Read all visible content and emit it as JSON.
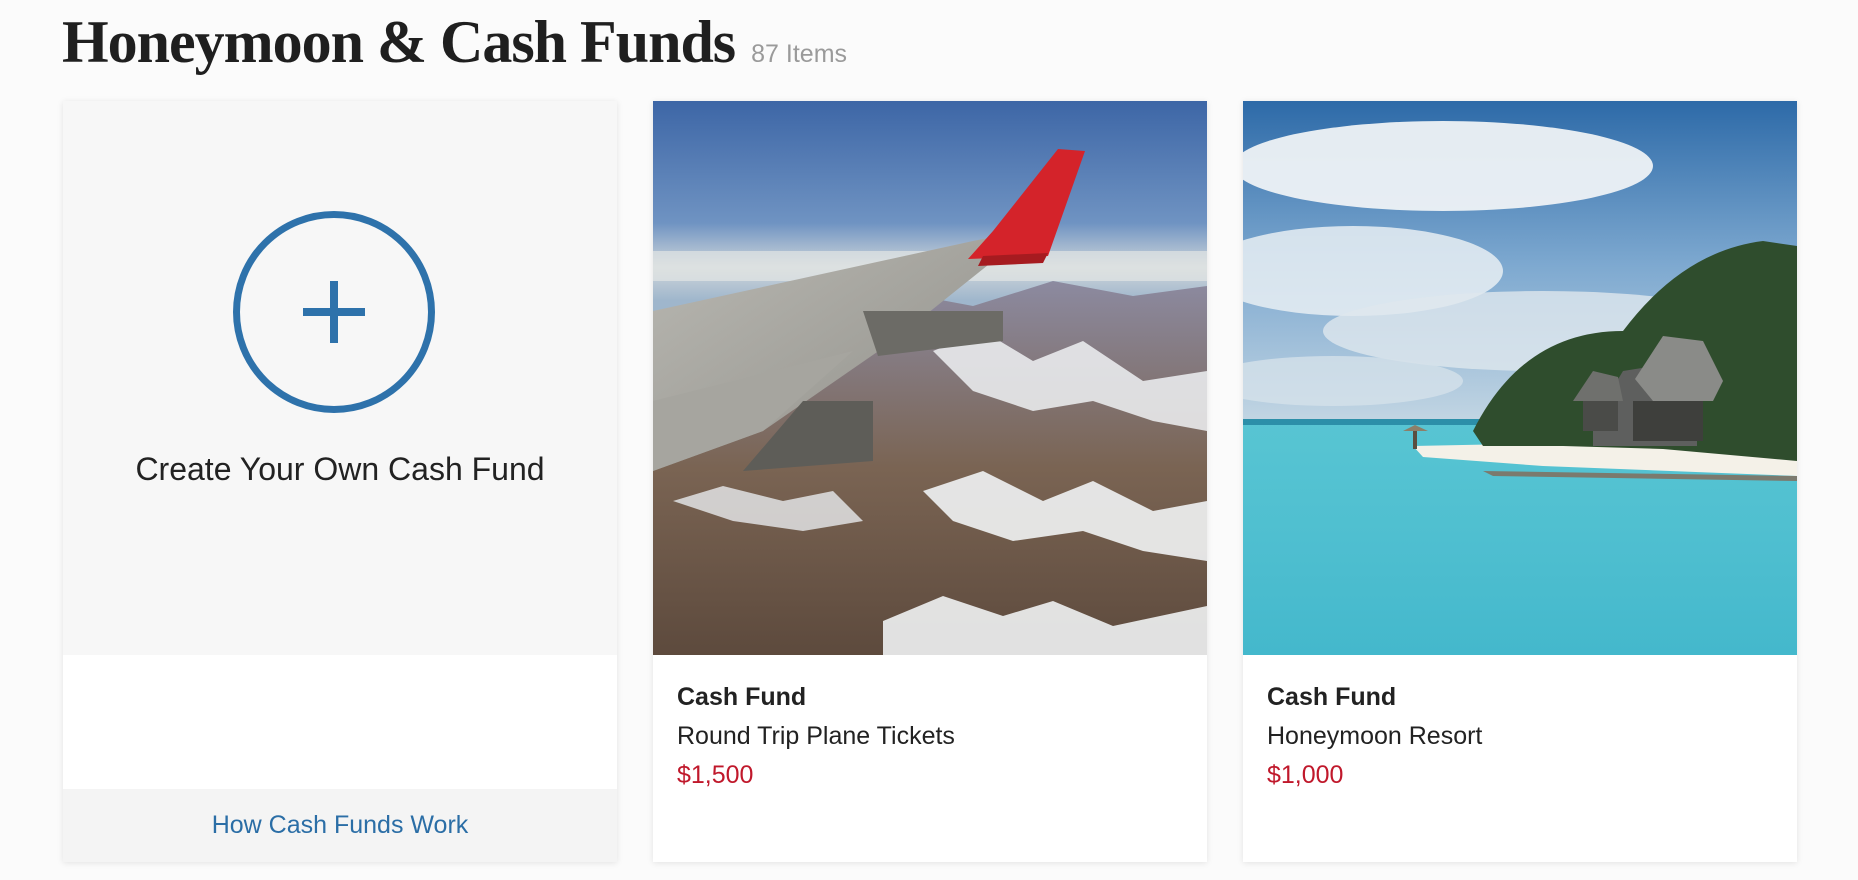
{
  "header": {
    "title": "Honeymoon & Cash Funds",
    "count": "87 Items"
  },
  "create_card": {
    "label": "Create Your Own Cash Fund",
    "link": "How Cash Funds Work",
    "icon": "plus-circle-icon",
    "accent_color": "#2e72ab"
  },
  "funds": [
    {
      "type": "Cash Fund",
      "name": "Round Trip Plane Tickets",
      "price": "$1,500",
      "image": "airplane wing over snowy mountains"
    },
    {
      "type": "Cash Fund",
      "name": "Honeymoon Resort",
      "price": "$1,000",
      "image": "tropical beach with overwater villas"
    }
  ],
  "colors": {
    "price": "#c0182b",
    "link": "#2b6ea6"
  }
}
